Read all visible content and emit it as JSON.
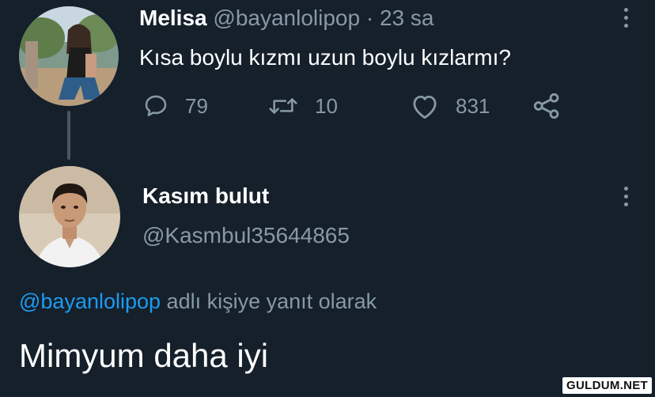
{
  "tweet": {
    "author_name": "Melisa",
    "author_handle": "@bayanlolipop",
    "separator": "·",
    "time": "23 sa",
    "text": "Kısa boylu kızmı uzun boylu kızlarmı?",
    "actions": {
      "reply_count": "79",
      "retweet_count": "10",
      "like_count": "831"
    },
    "icons": {
      "avatar": "profile-photo-woman",
      "more": "more-vertical-icon",
      "reply": "speech-bubble-icon",
      "retweet": "retweet-icon",
      "like": "heart-icon",
      "share": "share-icon"
    }
  },
  "reply": {
    "author_name": "Kasım bulut",
    "author_handle": "@Kasmbul35644865",
    "reply_to_mention": "@bayanlolipop",
    "reply_to_suffix": " adlı kişiye yanıt olarak",
    "text": "Mimyum daha iyi",
    "icons": {
      "avatar": "profile-photo-man",
      "more": "more-vertical-icon"
    }
  },
  "watermark": "GULDUM.NET",
  "colors": {
    "background": "#15202b",
    "primary_text": "#ffffff",
    "secondary_text": "#8899a6",
    "mention": "#1d9bf0"
  }
}
